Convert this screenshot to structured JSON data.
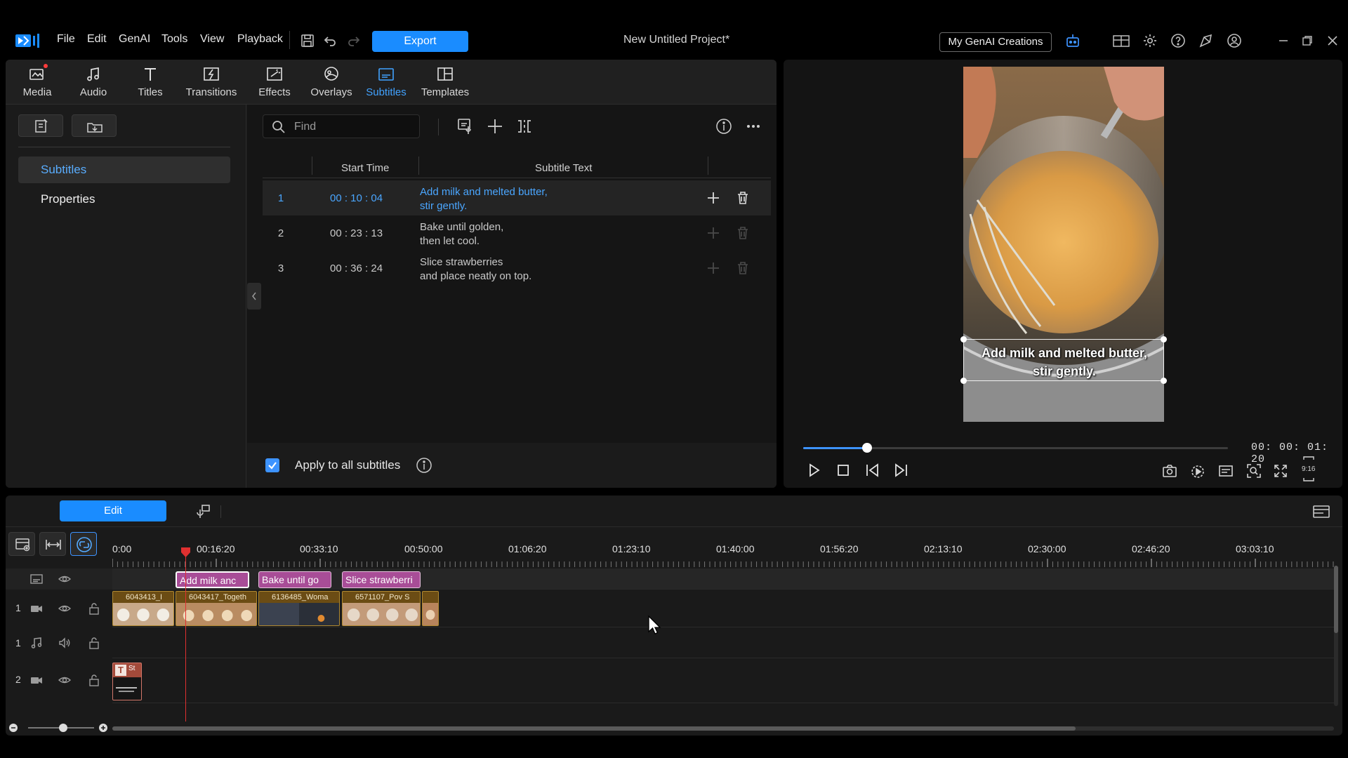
{
  "app": {
    "menu": [
      "File",
      "Edit",
      "GenAI",
      "Tools",
      "View",
      "Playback"
    ],
    "export_label": "Export",
    "project_title": "New Untitled Project*",
    "genai_button": "My GenAI Creations",
    "accent": "#1a8cff"
  },
  "tabs": [
    {
      "label": "Media",
      "icon": "media-icon"
    },
    {
      "label": "Audio",
      "icon": "music-note-icon"
    },
    {
      "label": "Titles",
      "icon": "title-t-icon"
    },
    {
      "label": "Transitions",
      "icon": "transitions-icon"
    },
    {
      "label": "Effects",
      "icon": "effects-icon"
    },
    {
      "label": "Overlays",
      "icon": "overlays-icon"
    },
    {
      "label": "Subtitles",
      "icon": "subtitles-icon",
      "active": true
    },
    {
      "label": "Templates",
      "icon": "templates-icon"
    }
  ],
  "leftnav": {
    "items": [
      {
        "label": "Subtitles",
        "active": true
      },
      {
        "label": "Properties",
        "active": false
      }
    ]
  },
  "subtitles": {
    "search_placeholder": "Find",
    "columns": {
      "start": "Start Time",
      "text": "Subtitle Text"
    },
    "rows": [
      {
        "num": "1",
        "start": "00 : 10 : 04",
        "text": "Add milk and melted butter,\nstir gently.",
        "selected": true
      },
      {
        "num": "2",
        "start": "00 : 23 : 13",
        "text": "Bake until golden,\nthen let cool.",
        "selected": false
      },
      {
        "num": "3",
        "start": "00 : 36 : 24",
        "text": "Slice strawberries\nand place neatly on top.",
        "selected": false
      }
    ],
    "apply_all_label": "Apply to all subtitles",
    "apply_all_checked": true
  },
  "preview": {
    "overlay_text": "Add milk and melted butter,\nstir gently.",
    "timecode": "00: 00: 01: 20",
    "progress": 0.15,
    "aspect_label": "9:16"
  },
  "timeline": {
    "mode_label": "Edit",
    "ticks": [
      "0:00",
      "00:16:20",
      "00:33:10",
      "00:50:00",
      "01:06:20",
      "01:23:10",
      "01:40:00",
      "01:56:20",
      "02:13:10",
      "02:30:00",
      "02:46:20",
      "03:03:10"
    ],
    "subtitle_clips": [
      {
        "label": "Add milk anc",
        "selected": true
      },
      {
        "label": "Bake until go",
        "selected": false
      },
      {
        "label": "Slice strawberri",
        "selected": false
      }
    ],
    "video_clips": [
      "6043413_I",
      "6043417_Togeth",
      "6136485_Woma",
      "6571107_Pov S",
      ""
    ],
    "title_clip_label": "St",
    "tracks": [
      {
        "num": "1",
        "type": "video"
      },
      {
        "num": "1",
        "type": "audio"
      },
      {
        "num": "2",
        "type": "video"
      }
    ]
  }
}
